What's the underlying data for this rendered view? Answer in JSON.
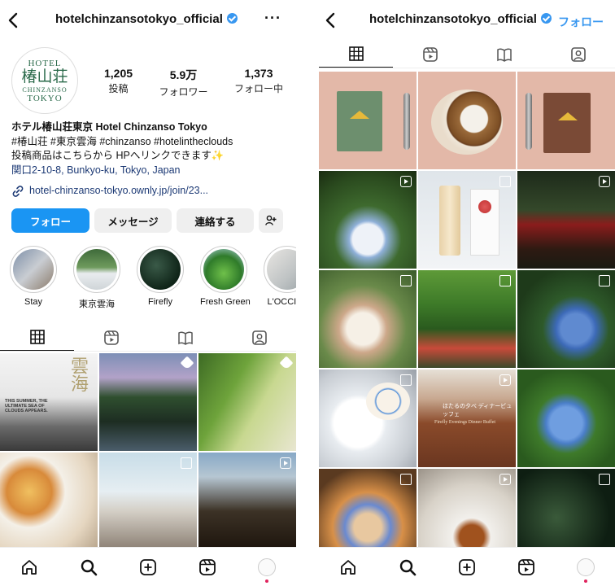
{
  "username": "hotelchinzansotokyo_official",
  "left": {
    "header": {
      "more_label": "···"
    },
    "avatar": {
      "line1": "HOTEL",
      "line2": "椿山荘",
      "line3": "CHINZANSO",
      "line4": "TOKYO"
    },
    "stats": [
      {
        "value": "1,205",
        "label": "投稿"
      },
      {
        "value": "5.9万",
        "label": "フォロワー"
      },
      {
        "value": "1,373",
        "label": "フォロー中"
      }
    ],
    "bio": {
      "name": "ホテル椿山荘東京 Hotel Chinzanso Tokyo",
      "hashtags": "#椿山荘 #東京雲海 #chinzanso #hotelintheclouds",
      "line3": "投稿商品はこちらから HPへリンクできます✨",
      "location": "関口2-10-8, Bunkyo-ku, Tokyo, Japan",
      "link": "hotel-chinzanso-tokyo.ownly.jp/join/23..."
    },
    "buttons": {
      "follow": "フォロー",
      "message": "メッセージ",
      "contact": "連絡する"
    },
    "highlights": [
      "Stay",
      "東京雲海",
      "Firefly",
      "Fresh Green",
      "L'OCCITA"
    ],
    "post_texts": {
      "cloud_title": "雲海",
      "cloud_caption": "THIS SUMMER, THE ULTIMATE SEA OF CLOUDS APPEARS."
    }
  },
  "right": {
    "follow_label": "フォロー",
    "post_texts": {
      "firefly_jp": "ほたるの夕べ ディナービュッフェ",
      "firefly_en": "Firefly Evenings Dinner Buffet"
    }
  },
  "colors": {
    "accent": "#1a95f3",
    "verified": "#3897f0",
    "notification": "#e0245e"
  },
  "icons": [
    "back-icon",
    "more-icon",
    "verified-icon",
    "grid-icon",
    "reels-icon",
    "guide-icon",
    "tagged-icon",
    "home-icon",
    "search-icon",
    "add-icon",
    "reels-nav-icon",
    "profile-icon",
    "add-person-icon",
    "link-icon"
  ]
}
